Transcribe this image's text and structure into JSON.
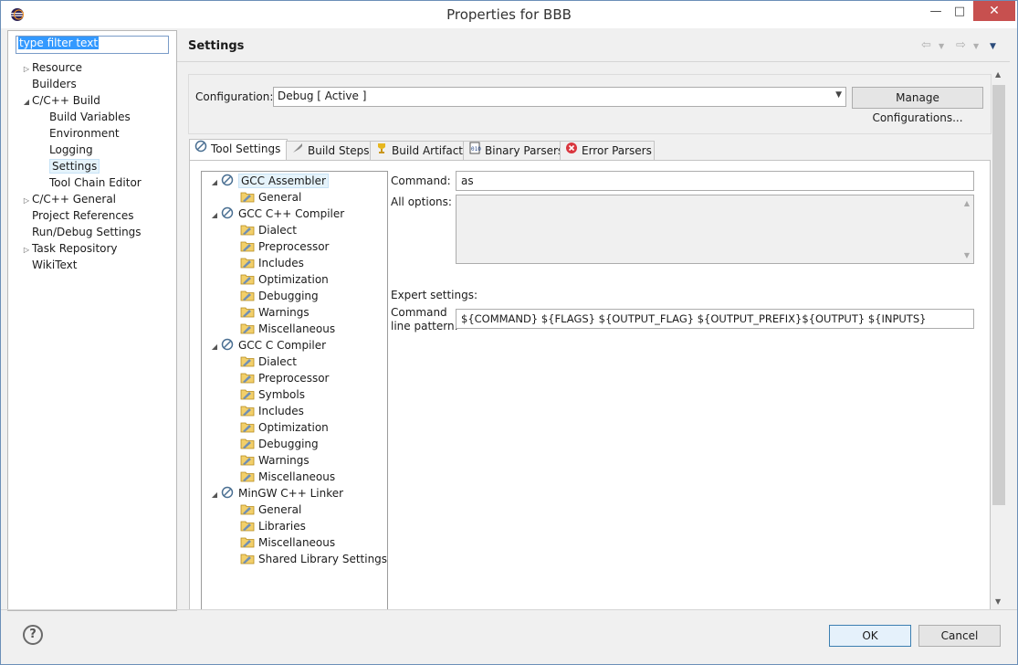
{
  "window": {
    "title": "Properties for BBB",
    "minimize": "—",
    "maximize": "□",
    "close": "✕"
  },
  "filter": {
    "placeholder": "type filter text"
  },
  "left_tree": [
    {
      "label": "Resource",
      "indent": 0,
      "arrow": "▷"
    },
    {
      "label": "Builders",
      "indent": 0,
      "arrow": ""
    },
    {
      "label": "C/C++ Build",
      "indent": 0,
      "arrow": "◢"
    },
    {
      "label": "Build Variables",
      "indent": 1,
      "arrow": ""
    },
    {
      "label": "Environment",
      "indent": 1,
      "arrow": ""
    },
    {
      "label": "Logging",
      "indent": 1,
      "arrow": ""
    },
    {
      "label": "Settings",
      "indent": 1,
      "arrow": "",
      "selected": true
    },
    {
      "label": "Tool Chain Editor",
      "indent": 1,
      "arrow": ""
    },
    {
      "label": "C/C++ General",
      "indent": 0,
      "arrow": "▷"
    },
    {
      "label": "Project References",
      "indent": 0,
      "arrow": ""
    },
    {
      "label": "Run/Debug Settings",
      "indent": 0,
      "arrow": ""
    },
    {
      "label": "Task Repository",
      "indent": 0,
      "arrow": "▷"
    },
    {
      "label": "WikiText",
      "indent": 0,
      "arrow": ""
    }
  ],
  "header": {
    "title": "Settings"
  },
  "configuration": {
    "label": "Configuration:",
    "value": "Debug  [ Active ]",
    "manage_label": "Manage Configurations..."
  },
  "tabs": [
    {
      "label": "Tool Settings",
      "icon": "tool-settings-icon",
      "active": true
    },
    {
      "label": "Build Steps",
      "icon": "build-steps-icon"
    },
    {
      "label": "Build Artifact",
      "icon": "build-artifact-icon"
    },
    {
      "label": "Binary Parsers",
      "icon": "binary-parsers-icon"
    },
    {
      "label": "Error Parsers",
      "icon": "error-parsers-icon"
    }
  ],
  "tool_tree": [
    {
      "label": "GCC Assembler",
      "level": 0,
      "selected": true
    },
    {
      "label": "General",
      "level": 1
    },
    {
      "label": "GCC C++ Compiler",
      "level": 0
    },
    {
      "label": "Dialect",
      "level": 1
    },
    {
      "label": "Preprocessor",
      "level": 1
    },
    {
      "label": "Includes",
      "level": 1
    },
    {
      "label": "Optimization",
      "level": 1
    },
    {
      "label": "Debugging",
      "level": 1
    },
    {
      "label": "Warnings",
      "level": 1
    },
    {
      "label": "Miscellaneous",
      "level": 1
    },
    {
      "label": "GCC C Compiler",
      "level": 0
    },
    {
      "label": "Dialect",
      "level": 1
    },
    {
      "label": "Preprocessor",
      "level": 1
    },
    {
      "label": "Symbols",
      "level": 1
    },
    {
      "label": "Includes",
      "level": 1
    },
    {
      "label": "Optimization",
      "level": 1
    },
    {
      "label": "Debugging",
      "level": 1
    },
    {
      "label": "Warnings",
      "level": 1
    },
    {
      "label": "Miscellaneous",
      "level": 1
    },
    {
      "label": "MinGW C++ Linker",
      "level": 0
    },
    {
      "label": "General",
      "level": 1
    },
    {
      "label": "Libraries",
      "level": 1
    },
    {
      "label": "Miscellaneous",
      "level": 1
    },
    {
      "label": "Shared Library Settings",
      "level": 1
    }
  ],
  "tool_panel": {
    "command_label": "Command:",
    "command_value": "as",
    "all_options_label": "All options:",
    "expert_label": "Expert settings:",
    "pattern_label_1": "Command",
    "pattern_label_2": "line pattern:",
    "pattern_value": "${COMMAND} ${FLAGS} ${OUTPUT_FLAG} ${OUTPUT_PREFIX}${OUTPUT} ${INPUTS}"
  },
  "footer": {
    "help": "?",
    "ok_label": "OK",
    "cancel_label": "Cancel"
  }
}
